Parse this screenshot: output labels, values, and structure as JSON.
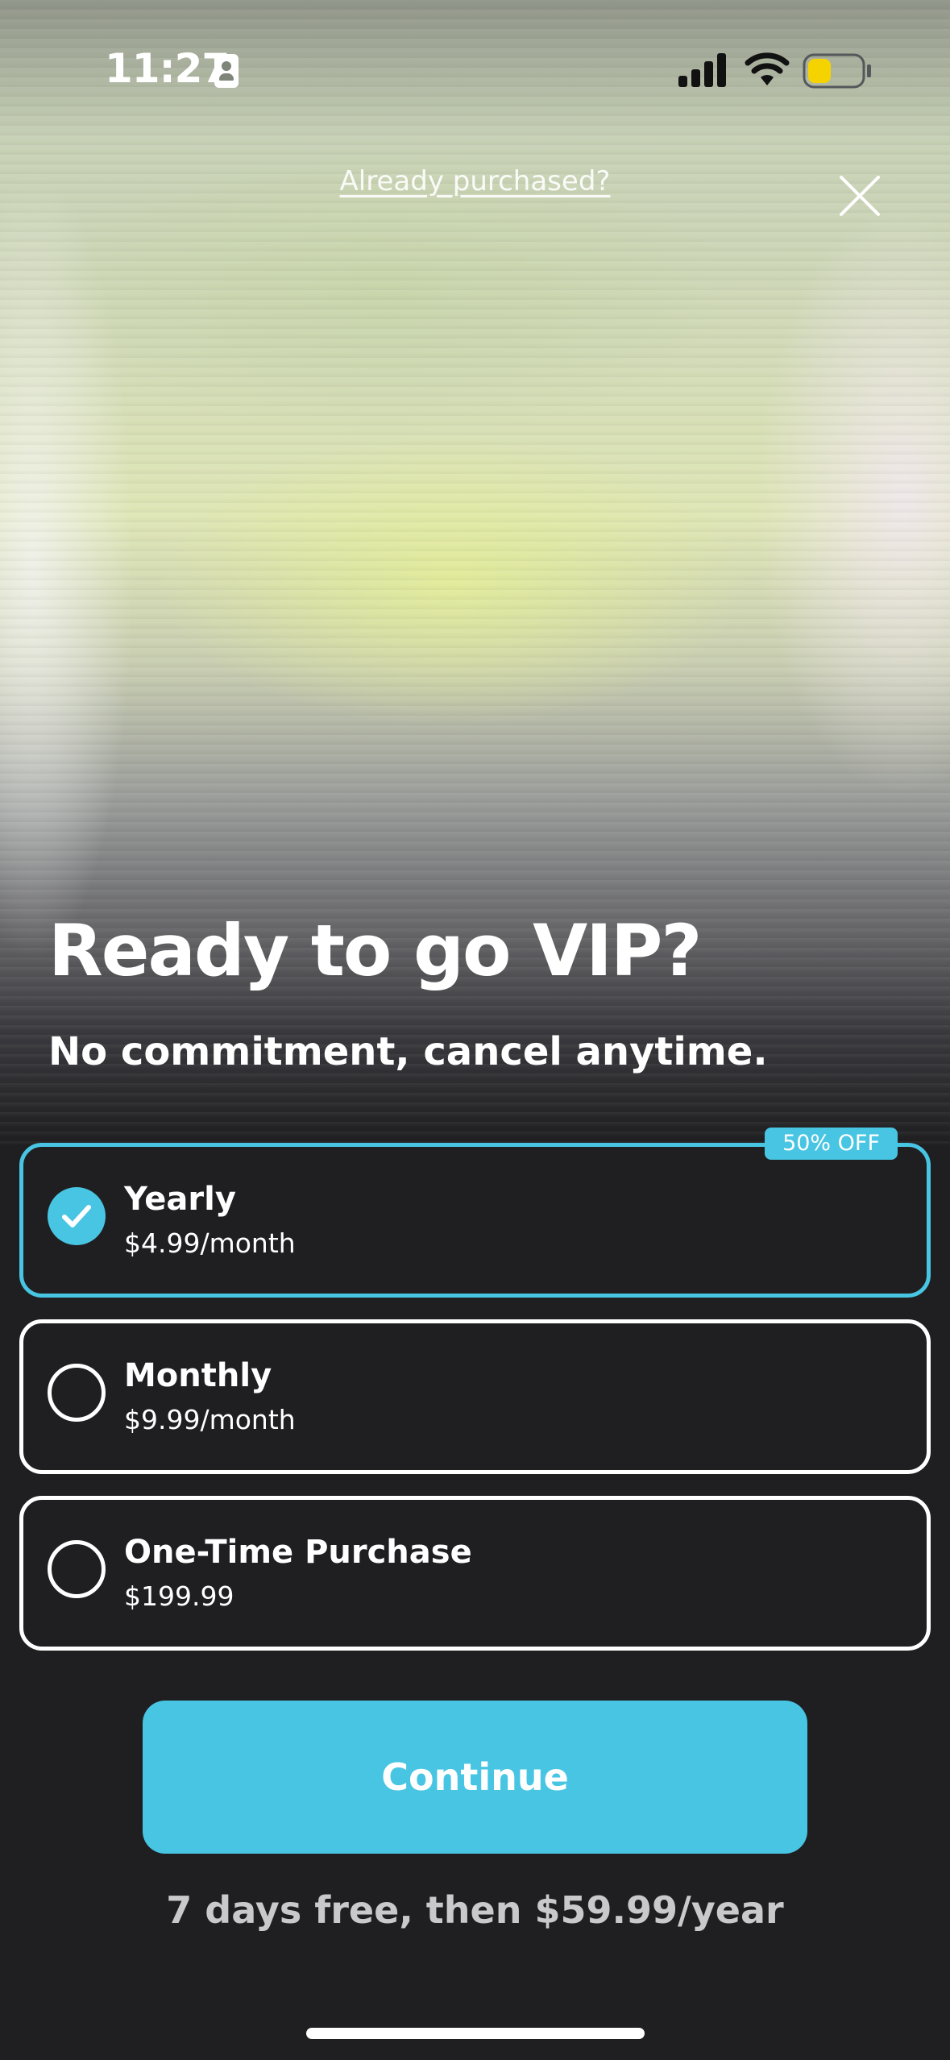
{
  "status_bar": {
    "time": "11:27",
    "icons": [
      "id-badge-icon",
      "signal-icon",
      "wifi-icon",
      "battery-icon"
    ],
    "battery_color": "#f5d300"
  },
  "header": {
    "already_purchased": "Already purchased?",
    "close_icon": "close-icon"
  },
  "hero": {
    "headline": "Ready to go VIP?",
    "subheadline": "No commitment, cancel anytime."
  },
  "plans": [
    {
      "name": "Yearly",
      "price": "$4.99/month",
      "badge": "50% OFF",
      "selected": true
    },
    {
      "name": "Monthly",
      "price": "$9.99/month",
      "selected": false
    },
    {
      "name": "One-Time Purchase",
      "price": "$199.99",
      "selected": false
    }
  ],
  "continue_label": "Continue",
  "trial_text": "7 days free, then $59.99/year",
  "colors": {
    "accent": "#48c5e2",
    "background": "#1f1f22",
    "text": "#ffffff",
    "muted_text": "#c9c9cc"
  }
}
